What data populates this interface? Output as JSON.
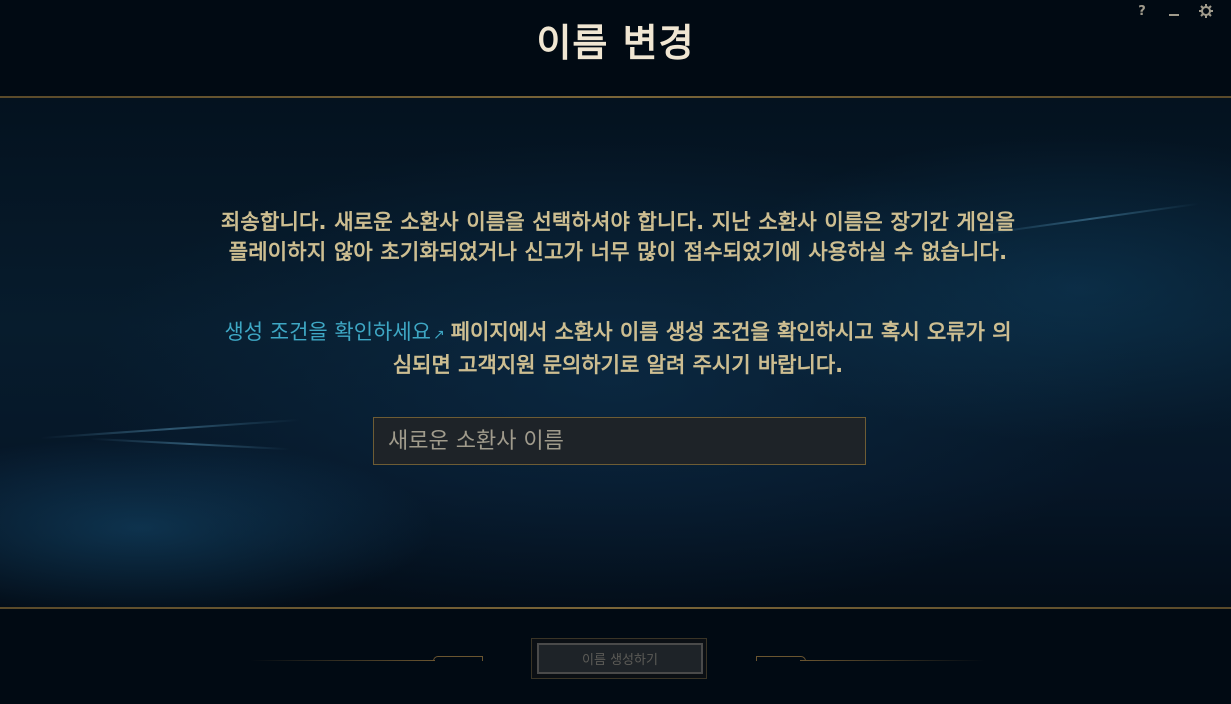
{
  "window": {
    "title": "이름 변경",
    "controls": {
      "help_label": "?",
      "minimize_icon": "minimize-icon",
      "settings_icon": "gear-icon"
    }
  },
  "main": {
    "message_1": "죄송합니다. 새로운 소환사 이름을 선택하셔야 합니다. 지난 소환사 이름은 장기간 게임을 플레이하지 않아 초기화되었거나 신고가 너무 많이 접수되었기에 사용하실 수 없습니다.",
    "link_text": "생성 조건을 확인하세요",
    "link_icon": "external-link-icon",
    "message_2_rest": "페이지에서 소환사 이름 생성 조건을 확인하시고 혹시 오류가 의심되면 고객지원 문의하기로 알려 주시기 바랍니다.",
    "input": {
      "placeholder": "새로운 소환사 이름",
      "value": ""
    }
  },
  "footer": {
    "create_button_label": "이름 생성하기"
  },
  "colors": {
    "title": "#f0e6d2",
    "body_text": "#cdbe91",
    "link": "#3ea7c4",
    "gold_rule": "#785a28",
    "background": "#010a13"
  }
}
